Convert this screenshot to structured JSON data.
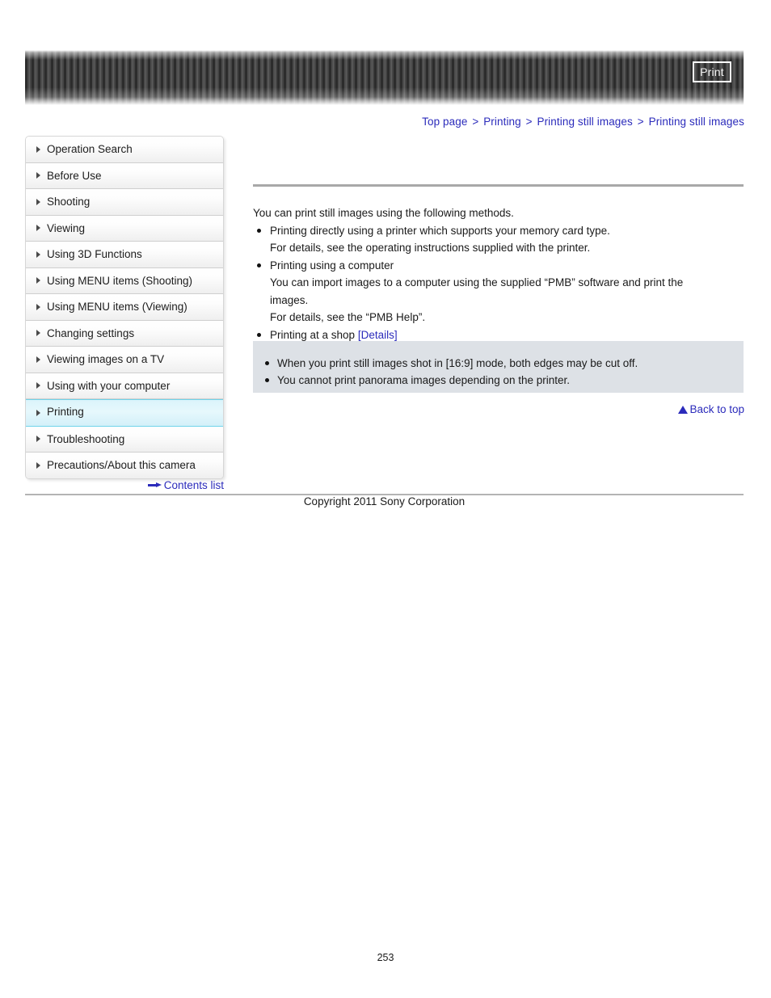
{
  "header": {
    "print_button_label": "Print"
  },
  "breadcrumb": {
    "separator": ">",
    "items": [
      {
        "label": "Top page"
      },
      {
        "label": "Printing"
      },
      {
        "label": "Printing still images"
      },
      {
        "label": "Printing still images"
      }
    ]
  },
  "sidebar": {
    "items": [
      {
        "label": "Operation Search",
        "active": false
      },
      {
        "label": "Before Use",
        "active": false
      },
      {
        "label": "Shooting",
        "active": false
      },
      {
        "label": "Viewing",
        "active": false
      },
      {
        "label": "Using 3D Functions",
        "active": false
      },
      {
        "label": "Using MENU items (Shooting)",
        "active": false
      },
      {
        "label": "Using MENU items (Viewing)",
        "active": false
      },
      {
        "label": "Changing settings",
        "active": false
      },
      {
        "label": "Viewing images on a TV",
        "active": false
      },
      {
        "label": "Using with your computer",
        "active": false
      },
      {
        "label": "Printing",
        "active": true
      },
      {
        "label": "Troubleshooting",
        "active": false
      },
      {
        "label": "Precautions/About this camera",
        "active": false
      }
    ],
    "contents_list_label": "Contents list"
  },
  "main": {
    "intro": "You can print still images using the following methods.",
    "methods": [
      {
        "line1": "Printing directly using a printer which supports your memory card type.",
        "line2": "For details, see the operating instructions supplied with the printer.",
        "line3": "",
        "line4": ""
      },
      {
        "line1": "Printing using a computer",
        "line2": "You can import images to a computer using the supplied “PMB” software and print the",
        "line3": "images.",
        "line4": "For details, see the “PMB Help”."
      },
      {
        "line1": "Printing at a shop ",
        "link": "[Details]"
      }
    ],
    "notes": [
      "When you print still images shot in [16:9] mode, both edges may be cut off.",
      "You cannot print panorama images depending on the printer."
    ],
    "back_to_top_label": "Back to top"
  },
  "footer": {
    "copyright": "Copyright 2011 Sony Corporation",
    "page_number": "253"
  },
  "colors": {
    "link_blue": "#2b2bbb",
    "active_item": "#dbf4fb",
    "note_background": "#dde1e6",
    "banner_dark": "#2c2c2c"
  }
}
